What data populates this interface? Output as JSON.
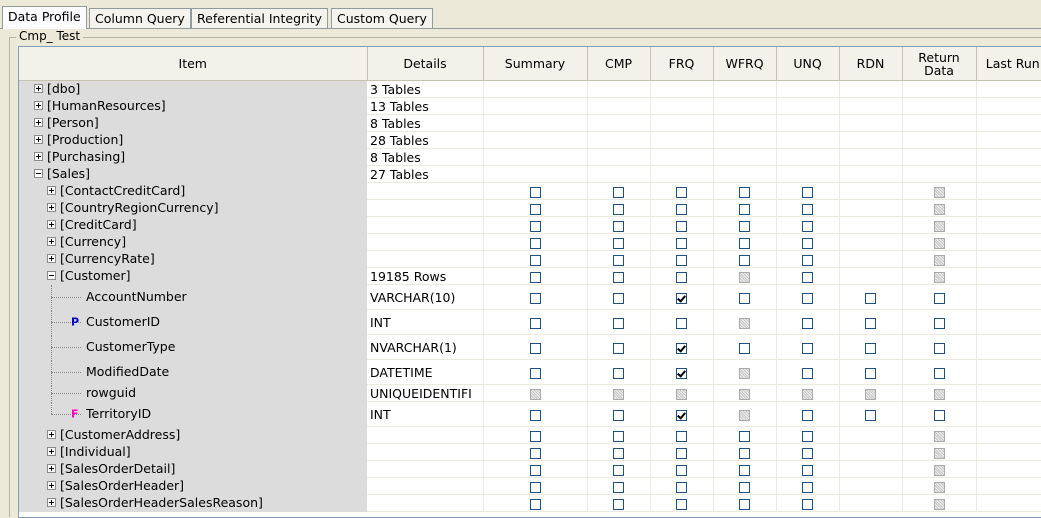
{
  "tabs": [
    "Data Profile",
    "Column Query",
    "Referential Integrity",
    "Custom Query"
  ],
  "active_tab": "Data Profile",
  "group_label": "Cmp_ Test",
  "columns": [
    "Item",
    "Details",
    "Summary",
    "CMP",
    "FRQ",
    "WFRQ",
    "UNQ",
    "RDN",
    "Return Data",
    "Last Run"
  ],
  "rows": [
    {
      "label": "[dbo]",
      "details": "3 Tables",
      "level": 0,
      "expander": "plus",
      "boxes": null
    },
    {
      "label": "[HumanResources]",
      "details": "13 Tables",
      "level": 0,
      "expander": "plus",
      "boxes": null
    },
    {
      "label": "[Person]",
      "details": "8 Tables",
      "level": 0,
      "expander": "plus",
      "boxes": null
    },
    {
      "label": "[Production]",
      "details": "28 Tables",
      "level": 0,
      "expander": "plus",
      "boxes": null
    },
    {
      "label": "[Purchasing]",
      "details": "8 Tables",
      "level": 0,
      "expander": "plus",
      "boxes": null
    },
    {
      "label": "[Sales]",
      "details": "27 Tables",
      "level": 0,
      "expander": "minus",
      "boxes": null
    },
    {
      "label": "[ContactCreditCard]",
      "details": "",
      "level": 1,
      "expander": "plus",
      "boxes": [
        "u",
        "u",
        "u",
        "u",
        "u",
        "",
        "d"
      ]
    },
    {
      "label": "[CountryRegionCurrency]",
      "details": "",
      "level": 1,
      "expander": "plus",
      "boxes": [
        "u",
        "u",
        "u",
        "u",
        "u",
        "",
        "d"
      ]
    },
    {
      "label": "[CreditCard]",
      "details": "",
      "level": 1,
      "expander": "plus",
      "boxes": [
        "u",
        "u",
        "u",
        "u",
        "u",
        "",
        "d"
      ]
    },
    {
      "label": "[Currency]",
      "details": "",
      "level": 1,
      "expander": "plus",
      "boxes": [
        "u",
        "u",
        "u",
        "u",
        "u",
        "",
        "d"
      ]
    },
    {
      "label": "[CurrencyRate]",
      "details": "",
      "level": 1,
      "expander": "plus",
      "boxes": [
        "u",
        "u",
        "u",
        "u",
        "u",
        "",
        "d"
      ]
    },
    {
      "label": "[Customer]",
      "details": "19185 Rows",
      "level": 1,
      "expander": "minus",
      "boxes": [
        "u",
        "u",
        "u",
        "d",
        "u",
        "",
        "d"
      ]
    },
    {
      "label": "AccountNumber",
      "details": "VARCHAR(10)",
      "level": 2,
      "key": "",
      "boxes": [
        "u",
        "u",
        "c",
        "u",
        "u",
        "u",
        "u"
      ],
      "tall": true
    },
    {
      "label": "CustomerID",
      "details": "INT",
      "level": 2,
      "key": "P",
      "boxes": [
        "u",
        "u",
        "u",
        "d",
        "u",
        "u",
        "u"
      ],
      "tall": true
    },
    {
      "label": "CustomerType",
      "details": "NVARCHAR(1)",
      "level": 2,
      "key": "",
      "boxes": [
        "u",
        "u",
        "c",
        "u",
        "u",
        "u",
        "u"
      ],
      "tall": true
    },
    {
      "label": "ModifiedDate",
      "details": "DATETIME",
      "level": 2,
      "key": "",
      "boxes": [
        "u",
        "u",
        "c",
        "d",
        "u",
        "u",
        "u"
      ],
      "tall": true
    },
    {
      "label": "rowguid",
      "details": "UNIQUEIDENTIFI",
      "level": 2,
      "key": "",
      "boxes": [
        "d",
        "d",
        "d",
        "d",
        "d",
        "d",
        "d"
      ],
      "tall": false
    },
    {
      "label": "TerritoryID",
      "details": "INT",
      "level": 2,
      "key": "F",
      "boxes": [
        "u",
        "u",
        "c",
        "d",
        "u",
        "u",
        "u"
      ],
      "tall": true,
      "last": true
    },
    {
      "label": "[CustomerAddress]",
      "details": "",
      "level": 1,
      "expander": "plus",
      "boxes": [
        "u",
        "u",
        "u",
        "u",
        "u",
        "",
        "d"
      ]
    },
    {
      "label": "[Individual]",
      "details": "",
      "level": 1,
      "expander": "plus",
      "boxes": [
        "u",
        "u",
        "u",
        "u",
        "u",
        "",
        "d"
      ]
    },
    {
      "label": "[SalesOrderDetail]",
      "details": "",
      "level": 1,
      "expander": "plus",
      "boxes": [
        "u",
        "u",
        "u",
        "u",
        "u",
        "",
        "d"
      ]
    },
    {
      "label": "[SalesOrderHeader]",
      "details": "",
      "level": 1,
      "expander": "plus",
      "boxes": [
        "u",
        "u",
        "u",
        "u",
        "u",
        "",
        "d"
      ]
    },
    {
      "label": "[SalesOrderHeaderSalesReason]",
      "details": "",
      "level": 1,
      "expander": "plus",
      "boxes": [
        "u",
        "u",
        "u",
        "u",
        "u",
        "",
        "d"
      ]
    }
  ]
}
